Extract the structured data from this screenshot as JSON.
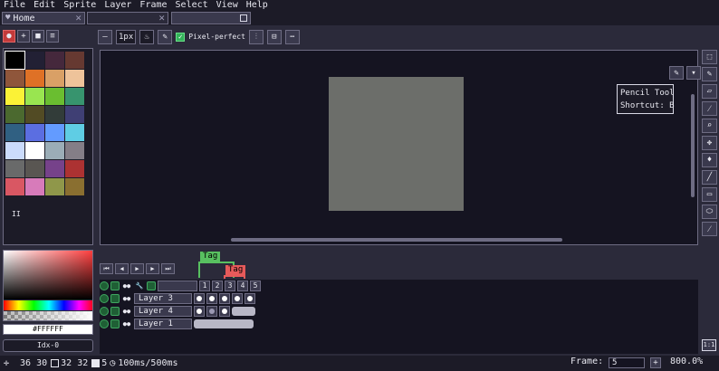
{
  "menu": [
    "File",
    "Edit",
    "Sprite",
    "Layer",
    "Frame",
    "Select",
    "View",
    "Help"
  ],
  "tabs": {
    "home": "Home"
  },
  "toolbar": {
    "brush_size": "1px",
    "pixel_perfect_label": "Pixel-perfect",
    "pixel_perfect_checked": true
  },
  "palette": {
    "colors": [
      "#000000",
      "#222034",
      "#45283c",
      "#663931",
      "#8f563b",
      "#df7126",
      "#d9a066",
      "#eec39a",
      "#fbf236",
      "#99e550",
      "#6abe30",
      "#37946e",
      "#4b692f",
      "#524b24",
      "#323c39",
      "#3f3f74",
      "#306082",
      "#5b6ee1",
      "#639bff",
      "#5fcde4",
      "#cbdbfc",
      "#ffffff",
      "#9badb7",
      "#847e87",
      "#696a6a",
      "#595652",
      "#76428a",
      "#ac3232",
      "#d95763",
      "#d77bba",
      "#8f974a",
      "#8a6f30"
    ],
    "footer": "II"
  },
  "color": {
    "hex": "#FFFFFF",
    "index": "Idx-0"
  },
  "tooltip": {
    "line1": "Pencil Tool",
    "line2": "Shortcut: B"
  },
  "timeline": {
    "tags": [
      "Tag",
      "Tag"
    ],
    "frames": [
      "1",
      "2",
      "3",
      "4",
      "5"
    ],
    "layers": [
      {
        "name": "Layer 3"
      },
      {
        "name": "Layer 4"
      },
      {
        "name": "Layer 1"
      }
    ]
  },
  "status": {
    "pos": "36 30",
    "size": "32 32",
    "frame_num": "5",
    "duration": "100ms/500ms",
    "frame_label": "Frame:",
    "frame_value": "5",
    "zoom": "800.0%"
  },
  "icons": [
    "pencil-icon",
    "eraser-icon",
    "eyedropper-icon",
    "zoom-icon",
    "move-icon",
    "bucket-icon",
    "line-icon",
    "rect-icon",
    "ellipse-icon",
    "blur-icon",
    "selection-icon"
  ]
}
